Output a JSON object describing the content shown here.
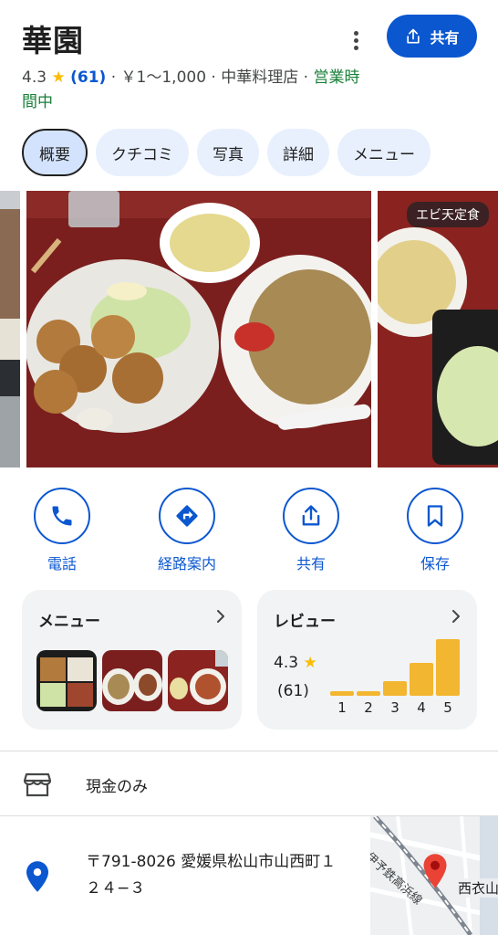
{
  "place": {
    "name": "華園",
    "rating": "4.3",
    "star": "★",
    "review_count": "(61)",
    "meta_sep1": " · ",
    "price": "￥1～1,000",
    "meta_sep2": " · ",
    "category": "中華料理店",
    "meta_sep3": " · ",
    "open_status": "営業時間中"
  },
  "header": {
    "share_label": "共有"
  },
  "tabs": [
    {
      "label": "概要",
      "active": true
    },
    {
      "label": "クチコミ"
    },
    {
      "label": "写真"
    },
    {
      "label": "詳細"
    },
    {
      "label": "メニュー"
    }
  ],
  "photos": {
    "third_badge": "エビ天定食"
  },
  "actions": [
    {
      "label": "電話",
      "icon": "phone-icon"
    },
    {
      "label": "経路案内",
      "icon": "directions-icon"
    },
    {
      "label": "共有",
      "icon": "share-icon"
    },
    {
      "label": "保存",
      "icon": "bookmark-icon"
    }
  ],
  "menu_card": {
    "title": "メニュー"
  },
  "review_card": {
    "title": "レビュー",
    "rating": "4.3",
    "star": "★",
    "count": "(61)",
    "histogram": [
      {
        "label": "1",
        "value": 1
      },
      {
        "label": "2",
        "value": 1
      },
      {
        "label": "3",
        "value": 3
      },
      {
        "label": "4",
        "value": 7
      },
      {
        "label": "5",
        "value": 12
      }
    ]
  },
  "info": {
    "payment": "現金のみ",
    "address": "〒791-8026 愛媛県松山市山西町１２４−３"
  },
  "map": {
    "rail_label": "伊予鉄高浜線",
    "station_label": "西衣山"
  },
  "colors": {
    "accent": "#0b57d0",
    "open": "#188038",
    "star": "#fbbc04",
    "bar": "#f3b630"
  }
}
